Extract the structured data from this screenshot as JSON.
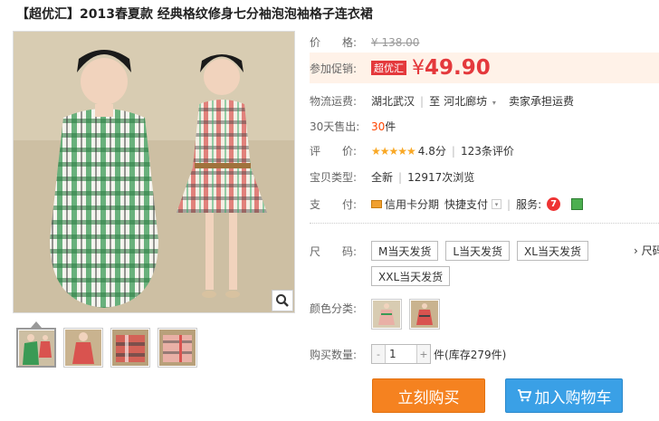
{
  "product": {
    "title": "【超优汇】2013春夏款 经典格纹修身七分袖泡泡袖格子连衣裙"
  },
  "price": {
    "label": "价　　格:",
    "original": "¥ 138.00",
    "promo_label": "参加促销:",
    "promo_badge": "超优汇",
    "yen": "¥",
    "promo_price": "49.90"
  },
  "shipping": {
    "label": "物流运费:",
    "from": "湖北武汉",
    "to_prefix": "至",
    "to": "河北廊坊",
    "fee": "卖家承担运费"
  },
  "sales": {
    "label": "30天售出:",
    "count": "30",
    "unit": "件"
  },
  "rating": {
    "label": "评　　价:",
    "stars": "★★★★★",
    "score": "4.8分",
    "reviews": "123条评价"
  },
  "item_type": {
    "label": "宝贝类型:",
    "type": "全新",
    "views": "12917次浏览"
  },
  "payment": {
    "label": "支　　付:",
    "credit": "信用卡分期",
    "quick": "快捷支付",
    "service_label": "服务:"
  },
  "size": {
    "label": "尺　　码:",
    "options": [
      "M当天发货",
      "L当天发货",
      "XL当天发货",
      "XXL当天发货"
    ],
    "more": "› 尺码"
  },
  "color": {
    "label": "颜色分类:"
  },
  "quantity": {
    "label": "购买数量:",
    "minus": "-",
    "value": "1",
    "plus": "+",
    "unit": "件",
    "stock": "(库存279件)"
  },
  "actions": {
    "buy": "立刻购买",
    "cart": "加入购物车"
  },
  "colors": {
    "accent": "#e4393c",
    "buy": "#f58220",
    "cart": "#3aa0e6"
  }
}
